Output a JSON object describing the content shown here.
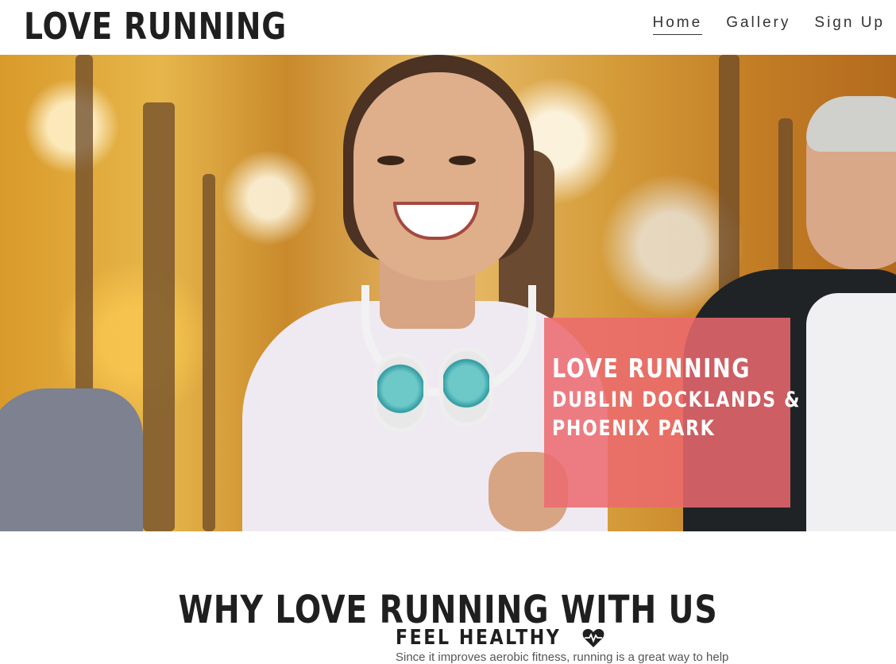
{
  "header": {
    "logo": "LOVE RUNNING",
    "nav": [
      {
        "label": "Home",
        "active": true
      },
      {
        "label": "Gallery",
        "active": false
      },
      {
        "label": "Sign Up",
        "active": false
      }
    ]
  },
  "hero": {
    "card_title": "LOVE RUNNING",
    "card_line1": "DUBLIN DOCKLANDS &",
    "card_line2": "PHOENIX PARK",
    "card_color": "#ec686e"
  },
  "section": {
    "title": "WHY LOVE RUNNING WITH US",
    "feature_title": "FEEL HEALTHY",
    "feature_icon": "heartbeat-icon",
    "feature_text": "Since it improves aerobic fitness, running is a great way to help"
  }
}
